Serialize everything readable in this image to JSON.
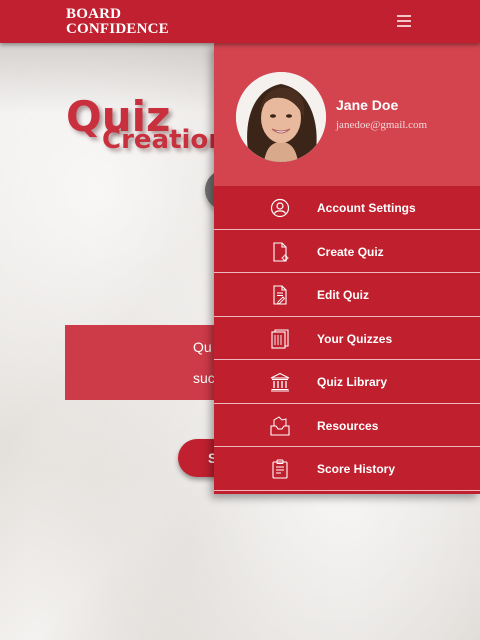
{
  "brand": {
    "line1": "BOARD",
    "line2": "CONFIDENCE"
  },
  "page": {
    "title_word1": "Quiz",
    "title_word2": "Creation",
    "message_line1": "Qu",
    "message_line2": "suc",
    "button_label": "S"
  },
  "drawer": {
    "user": {
      "name": "Jane Doe",
      "email": "janedoe@gmail.com"
    },
    "items": [
      {
        "label": "Account Settings",
        "icon": "user-icon"
      },
      {
        "label": "Create Quiz",
        "icon": "create-document-icon"
      },
      {
        "label": "Edit Quiz",
        "icon": "edit-document-icon"
      },
      {
        "label": "Your Quizzes",
        "icon": "documents-stack-icon"
      },
      {
        "label": "Quiz Library",
        "icon": "library-building-icon"
      },
      {
        "label": "Resources",
        "icon": "inbox-tray-icon"
      },
      {
        "label": "Score History",
        "icon": "clipboard-icon"
      }
    ]
  },
  "colors": {
    "primary": "#c0202f",
    "primary_light": "#d3444f",
    "divider": "#f0b8be"
  }
}
